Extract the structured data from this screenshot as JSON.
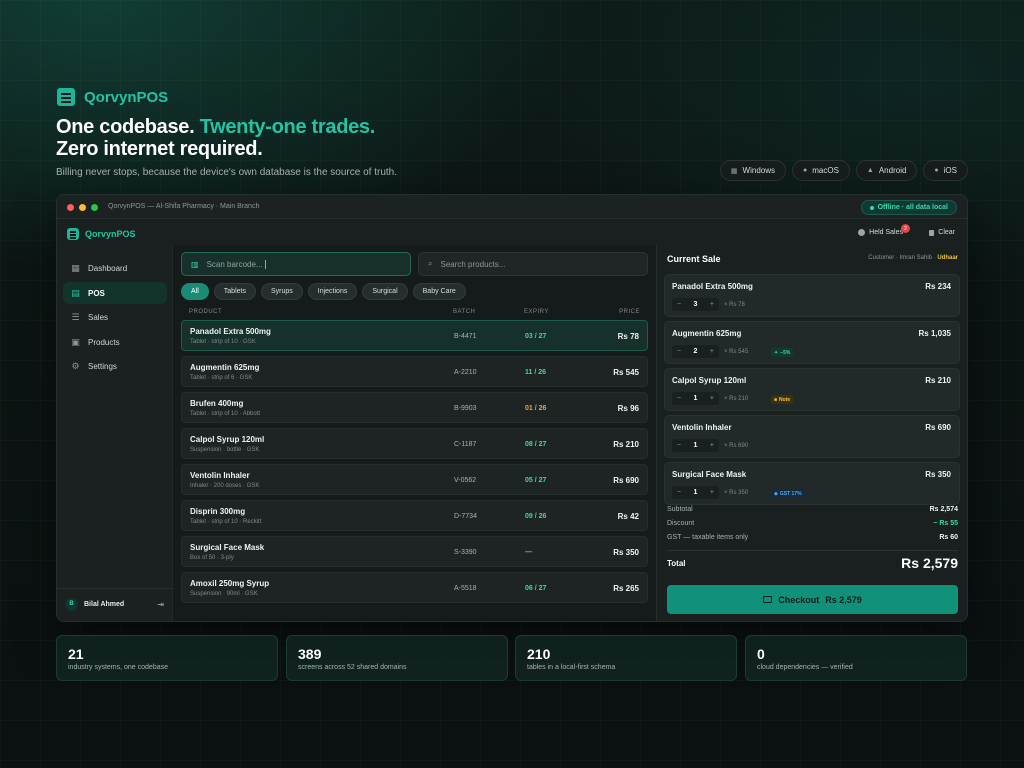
{
  "hero": {
    "brand": "QorvynPOS",
    "headline_part1": "One codebase. ",
    "headline_accent": "Twenty-one trades.",
    "headline_line2": "Zero internet required.",
    "tagline": "Billing never stops, because the device's own database is the source of truth.",
    "platforms": [
      "Windows",
      "macOS",
      "Android",
      "iOS"
    ]
  },
  "window": {
    "title": "QorvynPOS — Al-Shifa Pharmacy · Main Branch",
    "offline_label": "Offline · all data local",
    "app_name": "QorvynPOS",
    "held_label": "Held Sales",
    "held_count": "2",
    "clear_label": "Clear"
  },
  "sidebar": {
    "items": [
      {
        "label": "Dashboard",
        "icon": "grid-icon"
      },
      {
        "label": "POS",
        "icon": "receipt-icon"
      },
      {
        "label": "Sales",
        "icon": "list-icon"
      },
      {
        "label": "Products",
        "icon": "box-icon"
      },
      {
        "label": "Settings",
        "icon": "gear-icon"
      }
    ],
    "active_index": 1,
    "user_initial": "B",
    "user_name": "Bilal Ahmed"
  },
  "products": {
    "scan_placeholder": "Scan barcode...",
    "search_placeholder": "Search products...",
    "chips": [
      "All",
      "Tablets",
      "Syrups",
      "Injections",
      "Surgical",
      "Baby Care"
    ],
    "active_chip": 0,
    "headers": {
      "product": "PRODUCT",
      "batch": "BATCH",
      "expiry": "EXPIRY",
      "price": "PRICE"
    },
    "rows": [
      {
        "name": "Panadol Extra 500mg",
        "desc": "Tablet · strip of 10 · GSK",
        "batch": "B-4471",
        "expiry": "03 / 27",
        "price": "Rs 78",
        "status": "ok"
      },
      {
        "name": "Augmentin 625mg",
        "desc": "Tablet · strip of 6 · GSK",
        "batch": "A-2210",
        "expiry": "11 / 26",
        "price": "Rs 545",
        "status": "ok"
      },
      {
        "name": "Brufen 400mg",
        "desc": "Tablet · strip of 10 · Abbott",
        "batch": "B-9903",
        "expiry": "01 / 26",
        "price": "Rs 96",
        "status": "warn"
      },
      {
        "name": "Calpol Syrup 120ml",
        "desc": "Suspension · bottle · GSK",
        "batch": "C-1187",
        "expiry": "08 / 27",
        "price": "Rs 210",
        "status": "ok"
      },
      {
        "name": "Ventolin Inhaler",
        "desc": "Inhaler · 200 doses · GSK",
        "batch": "V-0562",
        "expiry": "05 / 27",
        "price": "Rs 690",
        "status": "ok"
      },
      {
        "name": "Disprin 300mg",
        "desc": "Tablet · strip of 10 · Reckitt",
        "batch": "D-7734",
        "expiry": "09 / 26",
        "price": "Rs 42",
        "status": "ok"
      },
      {
        "name": "Surgical Face Mask",
        "desc": "Box of 50 · 3-ply",
        "batch": "S-3390",
        "expiry": "—",
        "price": "Rs 350",
        "status": "ok"
      },
      {
        "name": "Amoxil 250mg Syrup",
        "desc": "Suspension · 90ml · GSK",
        "batch": "A-5518",
        "expiry": "06 / 27",
        "price": "Rs 265",
        "status": "ok"
      }
    ]
  },
  "sale": {
    "title": "Current Sale",
    "customer_prefix": "Customer · Imran Sahib · ",
    "customer_mode": "Udhaar",
    "items": [
      {
        "name": "Panadol Extra 500mg",
        "total": "Rs 234",
        "qty": "3",
        "unit": "× Rs 78",
        "tag": "",
        "tag_kind": ""
      },
      {
        "name": "Augmentin 625mg",
        "total": "Rs 1,035",
        "qty": "2",
        "unit": "× Rs 545",
        "tag": "−5%",
        "tag_kind": "green"
      },
      {
        "name": "Calpol Syrup 120ml",
        "total": "Rs 210",
        "qty": "1",
        "unit": "× Rs 210",
        "tag": "Note",
        "tag_kind": "yellow"
      },
      {
        "name": "Ventolin Inhaler",
        "total": "Rs 690",
        "qty": "1",
        "unit": "× Rs 690",
        "tag": "",
        "tag_kind": ""
      },
      {
        "name": "Surgical Face Mask",
        "total": "Rs 350",
        "qty": "1",
        "unit": "× Rs 350",
        "tag": "GST 17%",
        "tag_kind": "blue"
      }
    ],
    "subtotal_label": "Subtotal",
    "subtotal": "Rs 2,574",
    "discount_label": "Discount",
    "discount": "− Rs 55",
    "gst_label": "GST — taxable items only",
    "gst": "Rs 60",
    "total_label": "Total",
    "total": "Rs 2,579",
    "checkout_label": "Checkout",
    "checkout_amount": "Rs 2,579"
  },
  "stats": [
    {
      "value": "21",
      "label": "industry systems, one codebase"
    },
    {
      "value": "389",
      "label": "screens across 52 shared domains"
    },
    {
      "value": "210",
      "label": "tables in a local-first schema"
    },
    {
      "value": "0",
      "label": "cloud dependencies — verified"
    }
  ],
  "colors": {
    "accent": "#22c4a4",
    "ok": "#40d99b",
    "warn": "#f0a13b",
    "udhaar": "#f0c53b"
  }
}
